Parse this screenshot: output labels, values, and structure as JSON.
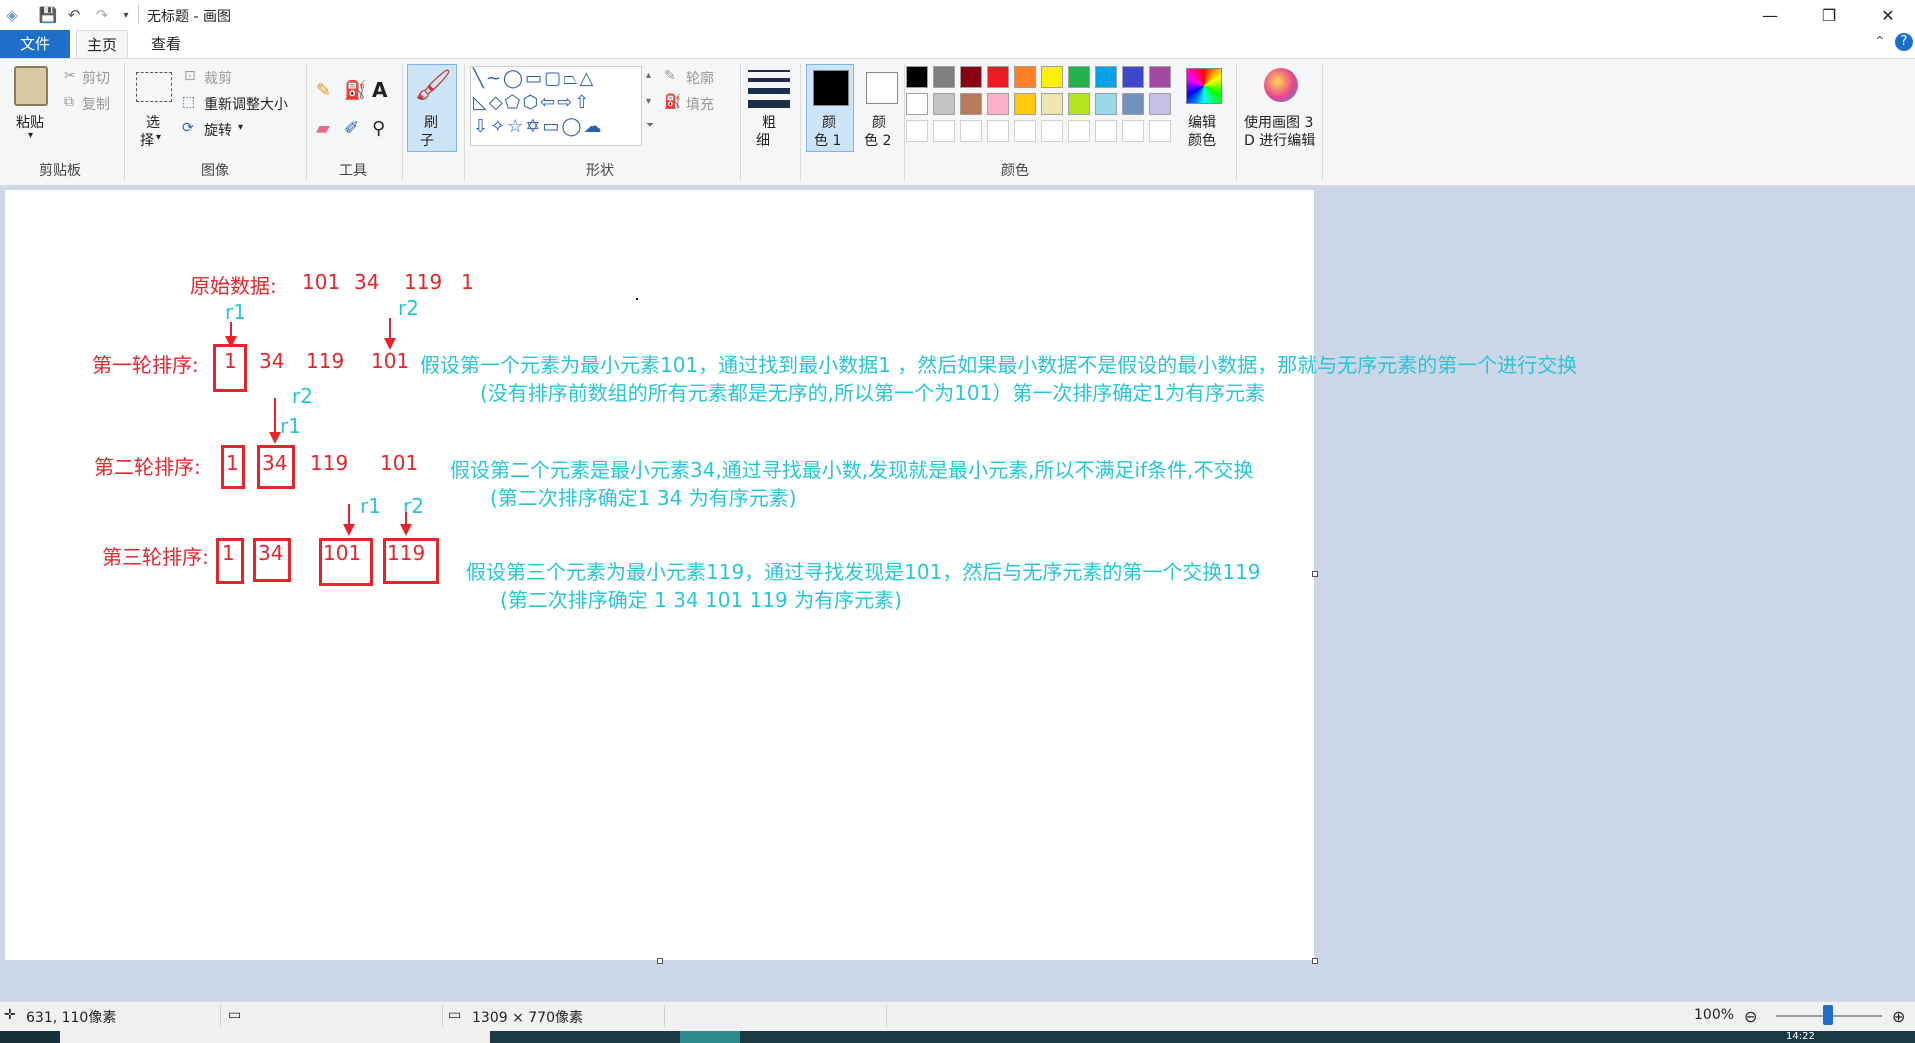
{
  "window": {
    "title": "无标题 - 画图",
    "minimize": "—",
    "maximize": "❐",
    "close": "✕"
  },
  "tabs": {
    "file": "文件",
    "home": "主页",
    "view": "查看"
  },
  "ribbon": {
    "clipboard": {
      "paste": "粘贴",
      "cut": "剪切",
      "copy": "复制",
      "group": "剪贴板"
    },
    "image": {
      "select": "选",
      "select2": "择",
      "crop": "裁剪",
      "resize": "重新调整大小",
      "rotate": "旋转",
      "group": "图像"
    },
    "tools": {
      "group": "工具"
    },
    "brushes": {
      "label1": "刷",
      "label2": "子"
    },
    "shapes": {
      "outline": "轮廓",
      "fill": "填充",
      "group": "形状"
    },
    "size": {
      "label1": "粗",
      "label2": "细"
    },
    "color1": {
      "label1": "颜",
      "label2": "色 1"
    },
    "color2": {
      "label1": "颜",
      "label2": "色 2"
    },
    "colors": {
      "group": "颜色",
      "edit1": "编辑",
      "edit2": "颜色",
      "palette": [
        "#000000",
        "#7f7f7f",
        "#880015",
        "#ed1c24",
        "#ff7f27",
        "#fff200",
        "#22b14c",
        "#00a2e8",
        "#3f48cc",
        "#a349a4",
        "#ffffff",
        "#c3c3c3",
        "#b97a57",
        "#ffaec9",
        "#ffc90e",
        "#efe4b0",
        "#b5e61d",
        "#99d9ea",
        "#7092be",
        "#c8bfe7"
      ]
    },
    "paint3d": {
      "line1": "使用画图 3",
      "line2": "D 进行编辑"
    }
  },
  "canvas": {
    "row0": {
      "label": "原始数据:",
      "nums": [
        "101",
        "34",
        "119",
        "1"
      ]
    },
    "row1": {
      "label": "第一轮排序:",
      "nums": [
        "1",
        "34",
        "119",
        "101"
      ],
      "r1": "r1",
      "r2": "r2",
      "note1": "假设第一个元素为最小元素101，通过找到最小数据1 ，然后如果最小数据不是假设的最小数据，那就与无序元素的第一个进行交换",
      "note2": "(没有排序前数组的所有元素都是无序的,所以第一个为101）第一次排序确定1为有序元素"
    },
    "row2": {
      "label": "第二轮排序:",
      "nums": [
        "1",
        "34",
        "119",
        "101"
      ],
      "r1": "r1",
      "r2": "r2",
      "note1": "假设第二个元素是最小元素34,通过寻找最小数,发现就是最小元素,所以不满足if条件,不交换",
      "note2": "(第二次排序确定1    34  为有序元素)"
    },
    "row3": {
      "label": "第三轮排序:",
      "nums": [
        "1",
        "34",
        "101",
        "119"
      ],
      "r1": "r1",
      "r2": "r2",
      "note1": "假设第三个元素为最小元素119，通过寻找发现是101，然后与无序元素的第一个交换119",
      "note2": "(第二次排序确定 1    34    101   119 为有序元素)"
    }
  },
  "status": {
    "cursor": "631, 110像素",
    "canvas_size": "1309 × 770像素",
    "zoom": "100%",
    "clock": "14:22"
  }
}
